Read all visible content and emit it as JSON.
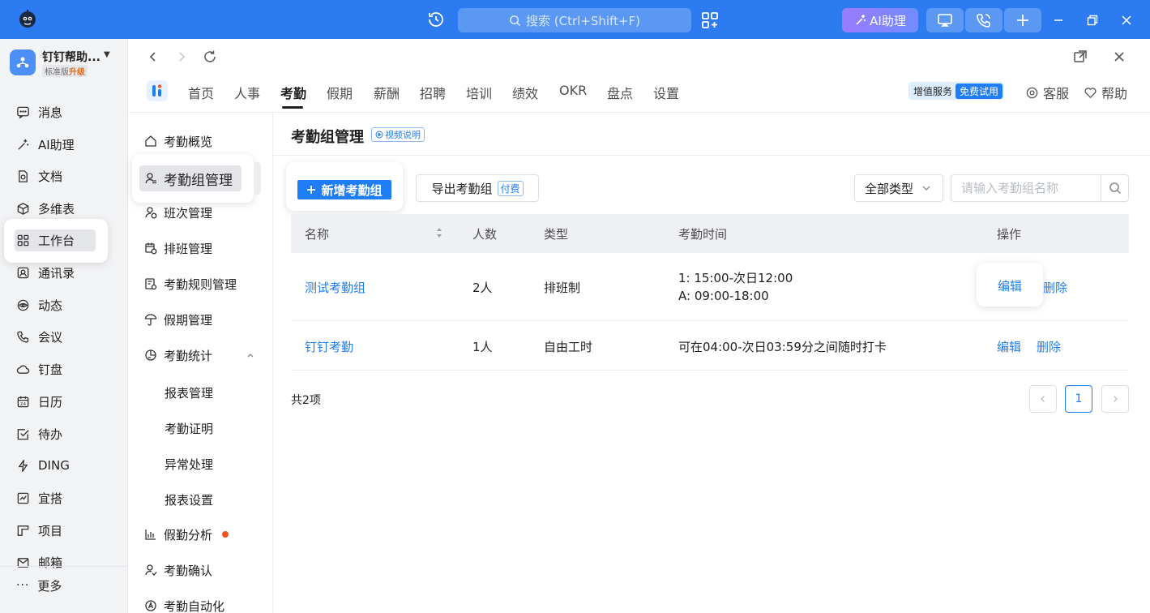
{
  "titlebar": {
    "search_placeholder": "搜索 (Ctrl+Shift+F)",
    "ai_label": "AI助理"
  },
  "org": {
    "name": "钉钉帮助...",
    "edition": "标准版",
    "upgrade": "升级"
  },
  "app_nav": [
    {
      "label": "消息",
      "icon": "chat-icon"
    },
    {
      "label": "AI助理",
      "icon": "sparkle-icon"
    },
    {
      "label": "文档",
      "icon": "document-icon"
    },
    {
      "label": "多维表",
      "icon": "cube-icon"
    },
    {
      "label": "工作台",
      "icon": "grid-icon"
    },
    {
      "label": "通讯录",
      "icon": "contacts-icon"
    },
    {
      "label": "动态",
      "icon": "eye-icon"
    },
    {
      "label": "会议",
      "icon": "phone-icon"
    },
    {
      "label": "钉盘",
      "icon": "cloud-icon"
    },
    {
      "label": "日历",
      "icon": "calendar-icon"
    },
    {
      "label": "待办",
      "icon": "checkbox-icon"
    },
    {
      "label": "DING",
      "icon": "lightning-icon"
    },
    {
      "label": "宜搭",
      "icon": "chart-box-icon"
    },
    {
      "label": "项目",
      "icon": "project-icon"
    },
    {
      "label": "邮箱",
      "icon": "mail-icon"
    }
  ],
  "app_nav_more": "更多",
  "module_tabs": [
    "首页",
    "人事",
    "考勤",
    "假期",
    "薪酬",
    "招聘",
    "培训",
    "绩效",
    "OKR",
    "盘点",
    "设置"
  ],
  "active_tab": "考勤",
  "value_added": {
    "label": "增值服务",
    "tag": "免费试用"
  },
  "service_link": "客服",
  "help_link": "帮助",
  "module_nav": [
    {
      "label": "考勤概览"
    },
    {
      "label": "考勤组管理"
    },
    {
      "label": "班次管理"
    },
    {
      "label": "排班管理"
    },
    {
      "label": "考勤规则管理"
    },
    {
      "label": "假期管理"
    },
    {
      "label": "考勤统计"
    }
  ],
  "module_nav_sub": [
    "报表管理",
    "考勤证明",
    "异常处理",
    "报表设置"
  ],
  "module_nav_rest": [
    {
      "label": "假勤分析"
    },
    {
      "label": "考勤确认"
    },
    {
      "label": "考勤自动化"
    }
  ],
  "page": {
    "title": "考勤组管理",
    "video_tag": "视频说明",
    "add_button": "新增考勤组",
    "export_button": "导出考勤组",
    "paid_tag": "付费",
    "type_select": "全部类型",
    "search_placeholder": "请输入考勤组名称"
  },
  "table": {
    "headers": [
      "名称",
      "人数",
      "类型",
      "考勤时间",
      "操作"
    ],
    "rows": [
      {
        "name": "测试考勤组",
        "count": "2人",
        "type": "排班制",
        "time_line1": "1: 15:00-次日12:00",
        "time_line2": "A: 09:00-18:00",
        "edit": "编辑",
        "delete": "删除"
      },
      {
        "name": "钉钉考勤",
        "count": "1人",
        "type": "自由工时",
        "time_line1": "可在04:00-次日03:59分之间随时打卡",
        "time_line2": "",
        "edit": "编辑",
        "delete": "删除"
      }
    ]
  },
  "footer": {
    "total": "共2项",
    "current_page": "1"
  },
  "colors": {
    "brand": "#2c7bf0",
    "link": "#1f7ef5",
    "dot": "#f0541e"
  }
}
